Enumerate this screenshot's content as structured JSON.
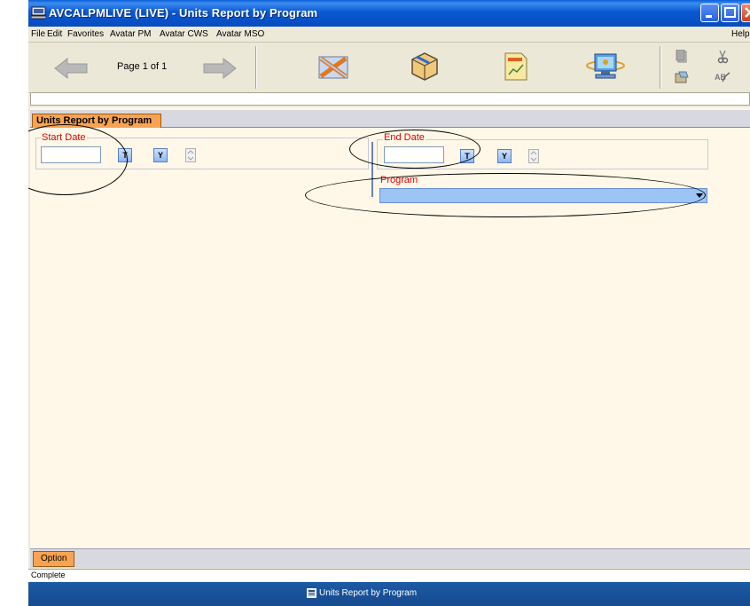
{
  "window": {
    "title": "AVCALPMLIVE (LIVE) - Units Report by Program"
  },
  "menu": {
    "items": [
      {
        "label": "File"
      },
      {
        "label": "Edit"
      },
      {
        "label": "Favorites"
      },
      {
        "label": "Avatar PM"
      },
      {
        "label": "Avatar CWS"
      },
      {
        "label": "Avatar MSO"
      },
      {
        "label": "Help"
      }
    ]
  },
  "toolbar": {
    "page_text": "Page 1 of 1",
    "icons": [
      "back-arrow-icon",
      "forward-arrow-icon",
      "close-form-icon",
      "submit-icon",
      "report-icon",
      "monitor-icon",
      "copy-icon",
      "cut-icon",
      "paste-icon",
      "spell-check-icon"
    ]
  },
  "form": {
    "tab_label": "Units Report by Program",
    "start_date": {
      "label": "Start Date",
      "value": "",
      "today_button": "T",
      "yesterday_button": "Y"
    },
    "end_date": {
      "label": "End Date",
      "value": "",
      "today_button": "T",
      "yesterday_button": "Y"
    },
    "program": {
      "label": "Program",
      "value": ""
    }
  },
  "bottom": {
    "option_tab": "Option"
  },
  "status": {
    "text": "Complete"
  },
  "taskbar": {
    "label": "Units Report by Program"
  },
  "colors": {
    "title_bar": "#0a58d0",
    "form_background": "#fff8e8",
    "tab_accent": "#f7a452",
    "field_label": "#e00000",
    "program_select": "#9cc4f4",
    "taskbar": "#154a8e"
  }
}
